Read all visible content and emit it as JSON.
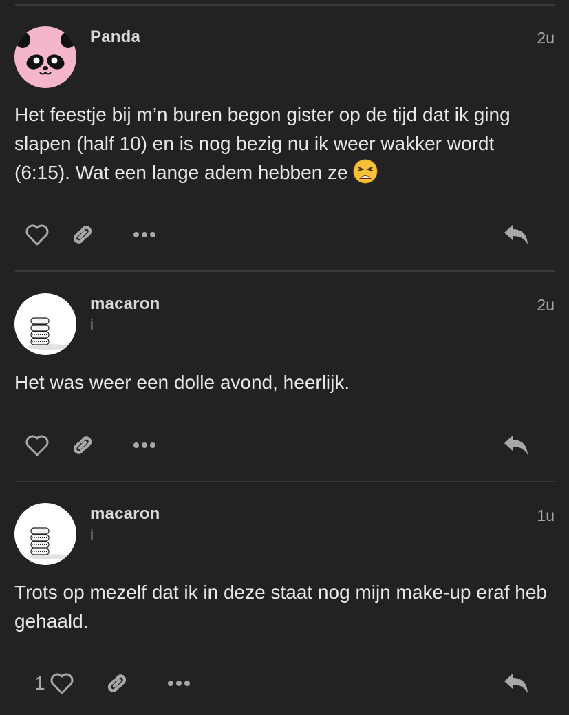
{
  "posts": [
    {
      "username": "Panda",
      "user_title": "",
      "time": "2u",
      "avatar": "panda-avatar",
      "body": "Het feestje bij m’n buren begon gister op de tijd dat ik ging slapen (half 10) en is nog bezig nu ik weer wakker wordt (6:15). Wat een lange adem hebben ze",
      "emoji": "weary-face-emoji",
      "like_count": ""
    },
    {
      "username": "macaron",
      "user_title": "i",
      "time": "2u",
      "avatar": "macaron-avatar",
      "body": "Het was weer een dolle avond, heerlijk.",
      "like_count": ""
    },
    {
      "username": "macaron",
      "user_title": "i",
      "time": "1u",
      "avatar": "macaron-avatar",
      "body": "Trots op mezelf dat ik in deze staat nog mijn make-up eraf heb gehaald.",
      "like_count": "1"
    }
  ],
  "icons": {
    "like": "heart-outline-icon",
    "link": "link-icon",
    "more": "ellipsis-icon",
    "reply": "reply-icon"
  },
  "colors": {
    "background": "#222222",
    "divider": "#3a3a3a",
    "text": "#e8e8e8",
    "muted": "#a8a8a8",
    "panda_pink": "#f4b6c8"
  }
}
